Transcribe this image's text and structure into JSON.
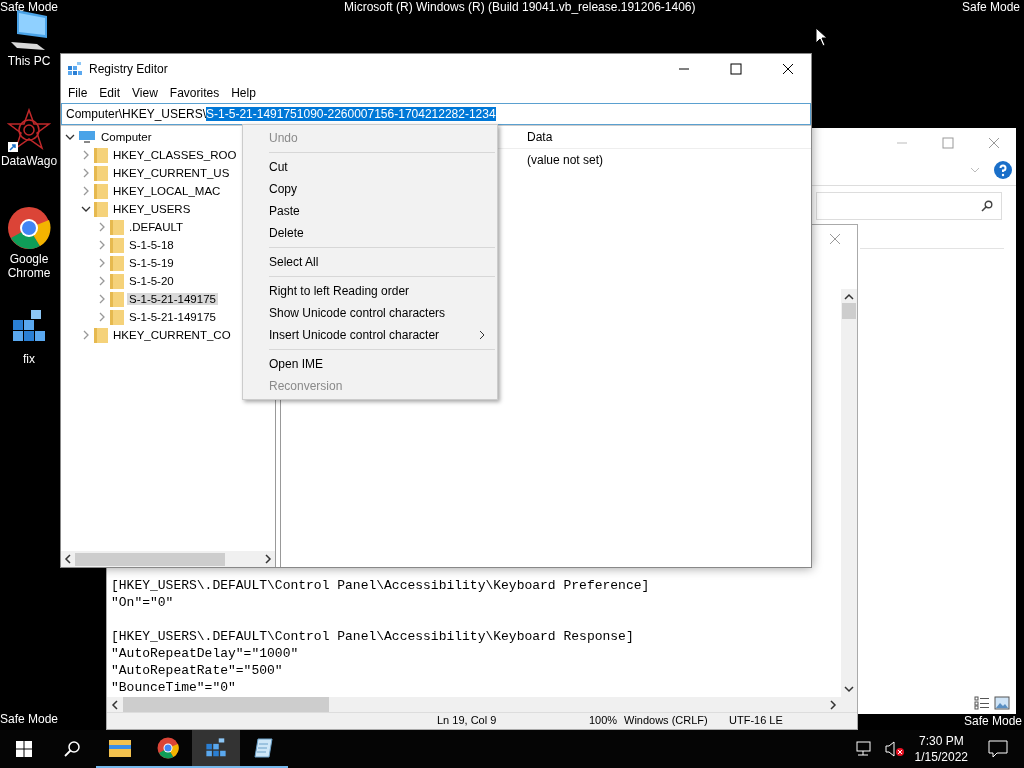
{
  "desktop": {
    "top_left": "Safe Mode",
    "title": "Microsoft (R) Windows (R) (Build 19041.vb_release.191206-1406)",
    "top_right": "Safe Mode",
    "bottom_left": "Safe Mode",
    "bottom_right": "Safe Mode"
  },
  "desktop_icons": [
    {
      "label": "This PC",
      "kind": "pc"
    },
    {
      "label": "DataWago",
      "kind": "star"
    },
    {
      "label": "Google Chrome",
      "kind": "chrome"
    },
    {
      "label": "fix",
      "kind": "registry"
    }
  ],
  "registry_editor": {
    "title": "Registry Editor",
    "menu": [
      "File",
      "Edit",
      "View",
      "Favorites",
      "Help"
    ],
    "address": {
      "path": "Computer\\HKEY_USERS\\",
      "selected_text": "S-1-5-21-1491751090-2260007156-1704212282-1234"
    },
    "tree": [
      {
        "label": "Computer",
        "kind": "computer",
        "expanded": true,
        "selected": false,
        "children": [
          {
            "label": "HKEY_CLASSES_ROO",
            "expanded": false,
            "selected": false
          },
          {
            "label": "HKEY_CURRENT_US",
            "expanded": false,
            "selected": false
          },
          {
            "label": "HKEY_LOCAL_MAC",
            "expanded": false,
            "selected": false
          },
          {
            "label": "HKEY_USERS",
            "expanded": true,
            "selected": false,
            "children": [
              {
                "label": ".DEFAULT",
                "expanded": false,
                "selected": false
              },
              {
                "label": "S-1-5-18",
                "expanded": false,
                "selected": false
              },
              {
                "label": "S-1-5-19",
                "expanded": false,
                "selected": false
              },
              {
                "label": "S-1-5-20",
                "expanded": false,
                "selected": false
              },
              {
                "label": "S-1-5-21-149175",
                "expanded": false,
                "selected": true
              },
              {
                "label": "S-1-5-21-149175",
                "expanded": false,
                "selected": false
              }
            ]
          },
          {
            "label": "HKEY_CURRENT_CO",
            "expanded": false,
            "selected": false
          }
        ]
      }
    ],
    "columns": [
      "Data"
    ],
    "values": [
      {
        "data": "(value not set)"
      }
    ]
  },
  "context_menu": [
    {
      "kind": "item",
      "label": "Undo",
      "disabled": true,
      "submenu": false
    },
    {
      "kind": "separator"
    },
    {
      "kind": "item",
      "label": "Cut",
      "disabled": false,
      "submenu": false
    },
    {
      "kind": "item",
      "label": "Copy",
      "disabled": false,
      "submenu": false
    },
    {
      "kind": "item",
      "label": "Paste",
      "disabled": false,
      "submenu": false
    },
    {
      "kind": "item",
      "label": "Delete",
      "disabled": false,
      "submenu": false
    },
    {
      "kind": "separator"
    },
    {
      "kind": "item",
      "label": "Select All",
      "disabled": false,
      "submenu": false
    },
    {
      "kind": "separator"
    },
    {
      "kind": "item",
      "label": "Right to left Reading order",
      "disabled": false,
      "submenu": false
    },
    {
      "kind": "item",
      "label": "Show Unicode control characters",
      "disabled": false,
      "submenu": false
    },
    {
      "kind": "item",
      "label": "Insert Unicode control character",
      "disabled": false,
      "submenu": true
    },
    {
      "kind": "separator"
    },
    {
      "kind": "item",
      "label": "Open IME",
      "disabled": false,
      "submenu": false
    },
    {
      "kind": "item",
      "label": "Reconversion",
      "disabled": true,
      "submenu": false
    }
  ],
  "notepad": {
    "blocks": [
      [
        "[HKEY_USERS\\.DEFAULT\\Control Panel\\Accessibility\\Keyboard Preference]",
        "\"On\"=\"0\""
      ],
      [
        "[HKEY_USERS\\.DEFAULT\\Control Panel\\Accessibility\\Keyboard Response]",
        "\"AutoRepeatDelay\"=\"1000\"",
        "\"AutoRepeatRate\"=\"500\"",
        "\"BounceTime\"=\"0\""
      ]
    ],
    "status": [
      "Ln 19, Col 9",
      "100%",
      "Windows (CRLF)",
      "UTF-16 LE"
    ]
  },
  "taskbar": {
    "apps": [
      {
        "kind": "explorer",
        "active": false
      },
      {
        "kind": "chrome",
        "active": false
      },
      {
        "kind": "regedit",
        "active": true
      },
      {
        "kind": "notepad",
        "active": false
      }
    ],
    "time": "7:30 PM",
    "date": "1/15/2022"
  }
}
